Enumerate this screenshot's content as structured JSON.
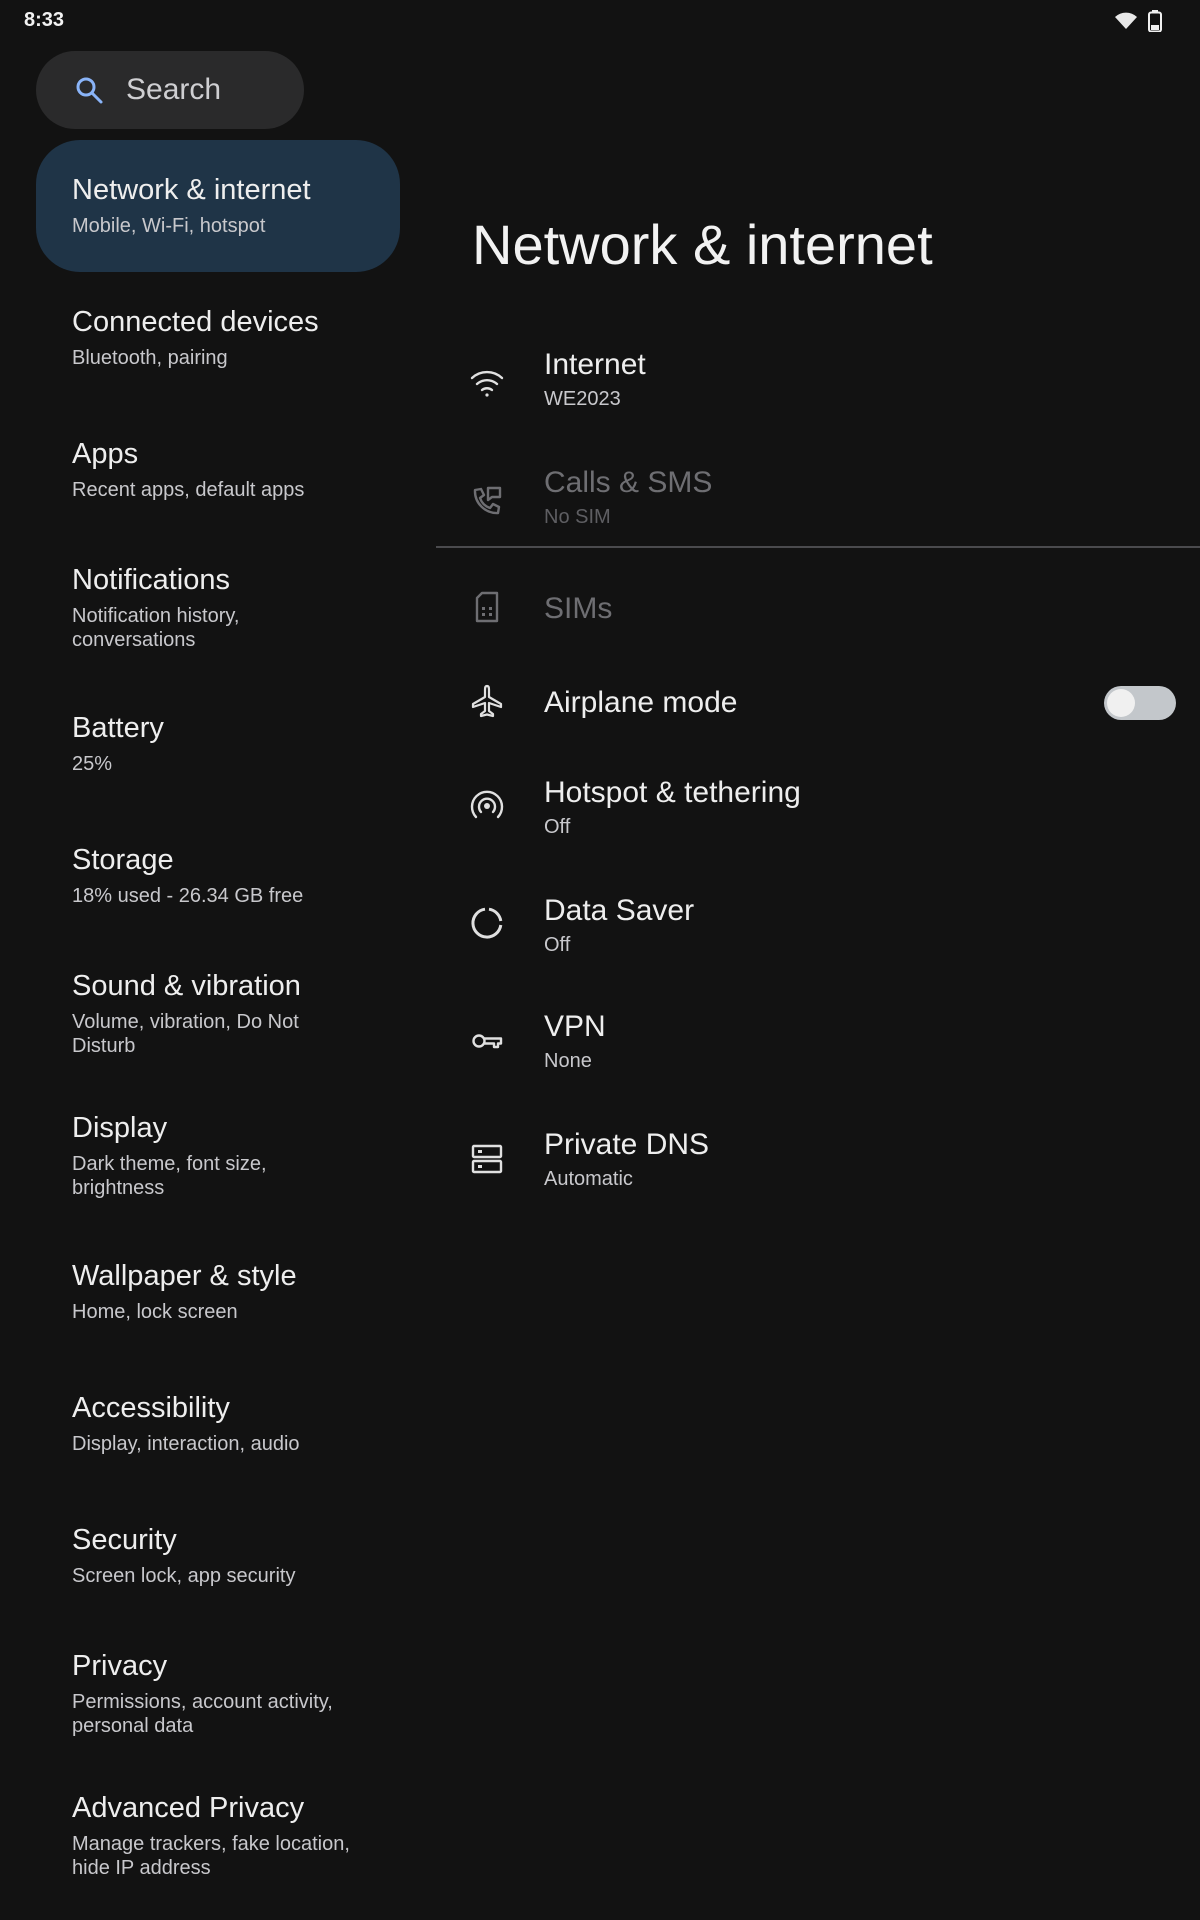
{
  "status_bar": {
    "time": "8:33",
    "icons": [
      "wifi-icon",
      "battery-icon"
    ]
  },
  "search": {
    "label": "Search"
  },
  "sidebar": {
    "items": [
      {
        "title": "Network & internet",
        "subtitle": "Mobile, Wi-Fi, hotspot",
        "selected": true
      },
      {
        "title": "Connected devices",
        "subtitle": "Bluetooth, pairing"
      },
      {
        "title": "Apps",
        "subtitle": "Recent apps, default apps"
      },
      {
        "title": "Notifications",
        "subtitle": "Notification history, conversations"
      },
      {
        "title": "Battery",
        "subtitle": "25%"
      },
      {
        "title": "Storage",
        "subtitle": "18% used - 26.34 GB free"
      },
      {
        "title": "Sound & vibration",
        "subtitle": "Volume, vibration, Do Not Disturb"
      },
      {
        "title": "Display",
        "subtitle": "Dark theme, font size, brightness"
      },
      {
        "title": "Wallpaper & style",
        "subtitle": "Home, lock screen"
      },
      {
        "title": "Accessibility",
        "subtitle": "Display, interaction, audio"
      },
      {
        "title": "Security",
        "subtitle": "Screen lock, app security"
      },
      {
        "title": "Privacy",
        "subtitle": "Permissions, account activity, personal data"
      },
      {
        "title": "Advanced Privacy",
        "subtitle": "Manage trackers, fake location, hide IP address"
      }
    ]
  },
  "main": {
    "title": "Network & internet",
    "prefs": [
      {
        "icon": "wifi-icon",
        "title": "Internet",
        "subtitle": "WE2023"
      },
      {
        "icon": "calls-sms-icon",
        "title": "Calls & SMS",
        "subtitle": "No SIM",
        "disabled": true
      },
      {
        "icon": "sim-card-icon",
        "title": "SIMs",
        "disabled": true
      },
      {
        "icon": "airplane-icon",
        "title": "Airplane mode",
        "toggle": "off"
      },
      {
        "icon": "hotspot-icon",
        "title": "Hotspot & tethering",
        "subtitle": "Off"
      },
      {
        "icon": "data-saver-icon",
        "title": "Data Saver",
        "subtitle": "Off"
      },
      {
        "icon": "vpn-key-icon",
        "title": "VPN",
        "subtitle": "None"
      },
      {
        "icon": "dns-icon",
        "title": "Private DNS",
        "subtitle": "Automatic"
      }
    ]
  },
  "colors": {
    "background": "#121212",
    "selected_item": "#1f3447",
    "search_bg": "#2a2a2b",
    "accent": "#8ab4f8"
  }
}
